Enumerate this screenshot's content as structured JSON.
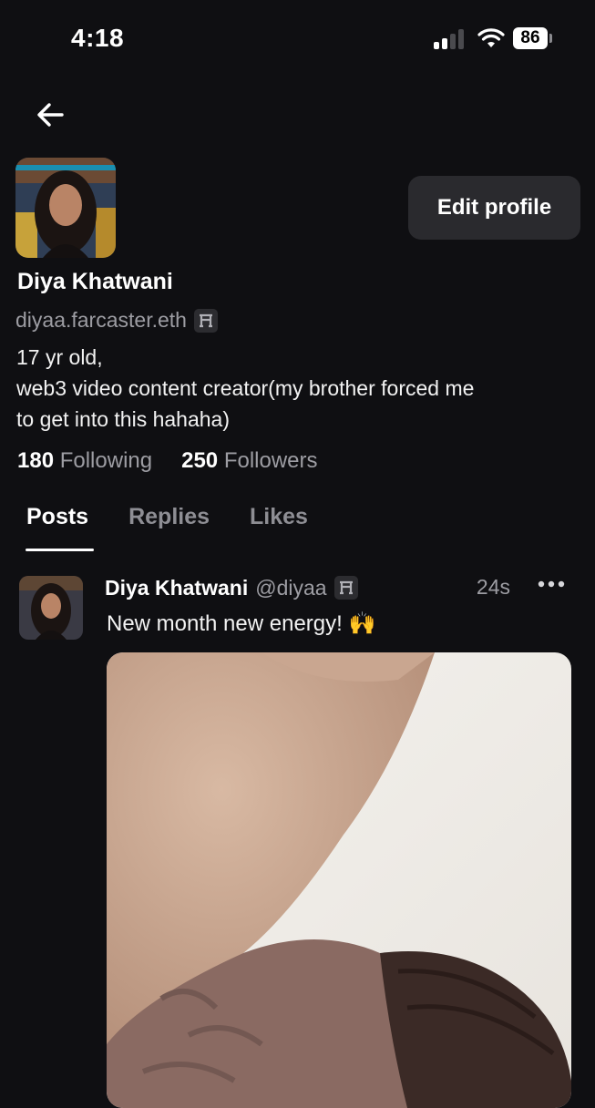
{
  "status_bar": {
    "time": "4:18",
    "battery": "86"
  },
  "profile": {
    "display_name": "Diya Khatwani",
    "handle": "diyaa.farcaster.eth",
    "bio_lines": [
      "17 yr old,",
      "web3 video content creator(my brother forced me",
      "to get into this hahaha)"
    ],
    "edit_button": "Edit profile",
    "following_count": "180",
    "following_label": "Following",
    "followers_count": "250",
    "followers_label": "Followers"
  },
  "tabs": [
    {
      "label": "Posts",
      "active": true
    },
    {
      "label": "Replies",
      "active": false
    },
    {
      "label": "Likes",
      "active": false
    }
  ],
  "post": {
    "author": "Diya Khatwani",
    "handle": "@diyaa",
    "time": "24s",
    "text": "New month new energy! 🙌"
  },
  "colors": {
    "background": "#0f0f12",
    "button_bg": "#2a2a2e",
    "muted_text": "#9d9da3"
  },
  "icons": [
    "back-arrow-icon",
    "signal-icon",
    "wifi-icon",
    "battery-icon",
    "power-badge-icon",
    "more-icon"
  ]
}
